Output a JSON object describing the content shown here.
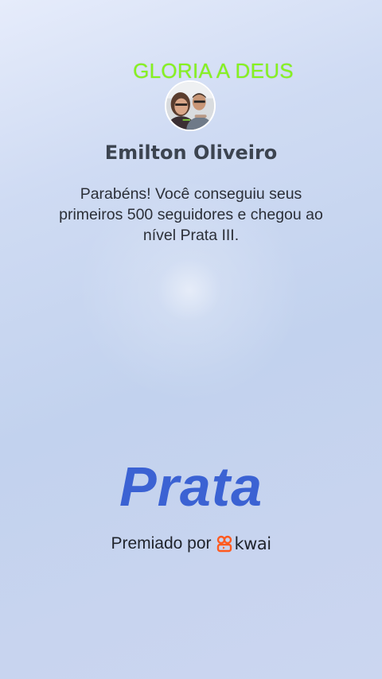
{
  "overlay": {
    "text": "GLORIA A DEUS"
  },
  "profile": {
    "name": "Emilton Oliveiro",
    "avatar": "user-photo"
  },
  "achievement": {
    "message": "Parabéns! Você conseguiu seus primeiros 500 seguidores e chegou ao nível Prata III.",
    "level": "Prata"
  },
  "footer": {
    "awarded_by": "Premiado por",
    "brand": "kwai"
  },
  "colors": {
    "overlay_text": "#86f21f",
    "level_title": "#3b62d3",
    "kwai_logo": "#ff5a1f"
  }
}
